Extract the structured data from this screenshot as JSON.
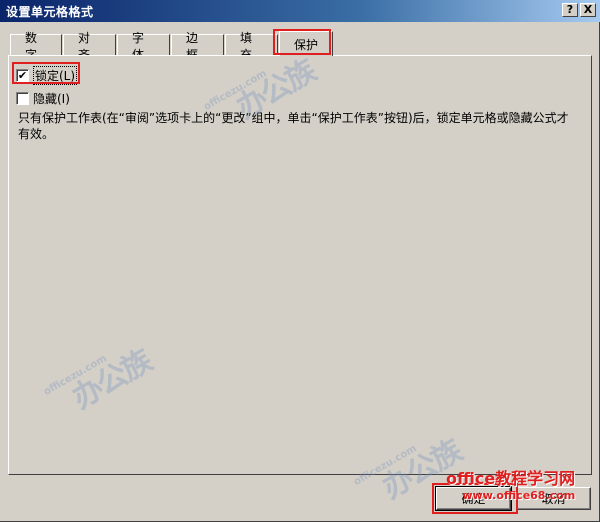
{
  "window": {
    "title": "设置单元格格式"
  },
  "titlebar_buttons": {
    "help": "?",
    "close": "X"
  },
  "tabs": [
    {
      "label": "数字"
    },
    {
      "label": "对齐"
    },
    {
      "label": "字体"
    },
    {
      "label": "边框"
    },
    {
      "label": "填充"
    },
    {
      "label": "保护"
    }
  ],
  "protection": {
    "locked": {
      "label": "锁定(L)",
      "checked": true,
      "mark": "✔"
    },
    "hidden": {
      "label": "隐藏(I)",
      "checked": false,
      "mark": ""
    },
    "description": "只有保护工作表(在“审阅”选项卡上的“更改”组中，单击“保护工作表”按钮)后，锁定单元格或隐藏公式才有效。"
  },
  "buttons": {
    "ok": "确定",
    "cancel": "取消"
  },
  "watermarks": {
    "small": "officezu.com",
    "big": "办公族"
  },
  "brand": {
    "name": "office教程学习网",
    "url": "www.office68.com"
  },
  "colors": {
    "highlight": "#e02020",
    "face": "#d4d0c8",
    "title_start": "#0a246a"
  }
}
